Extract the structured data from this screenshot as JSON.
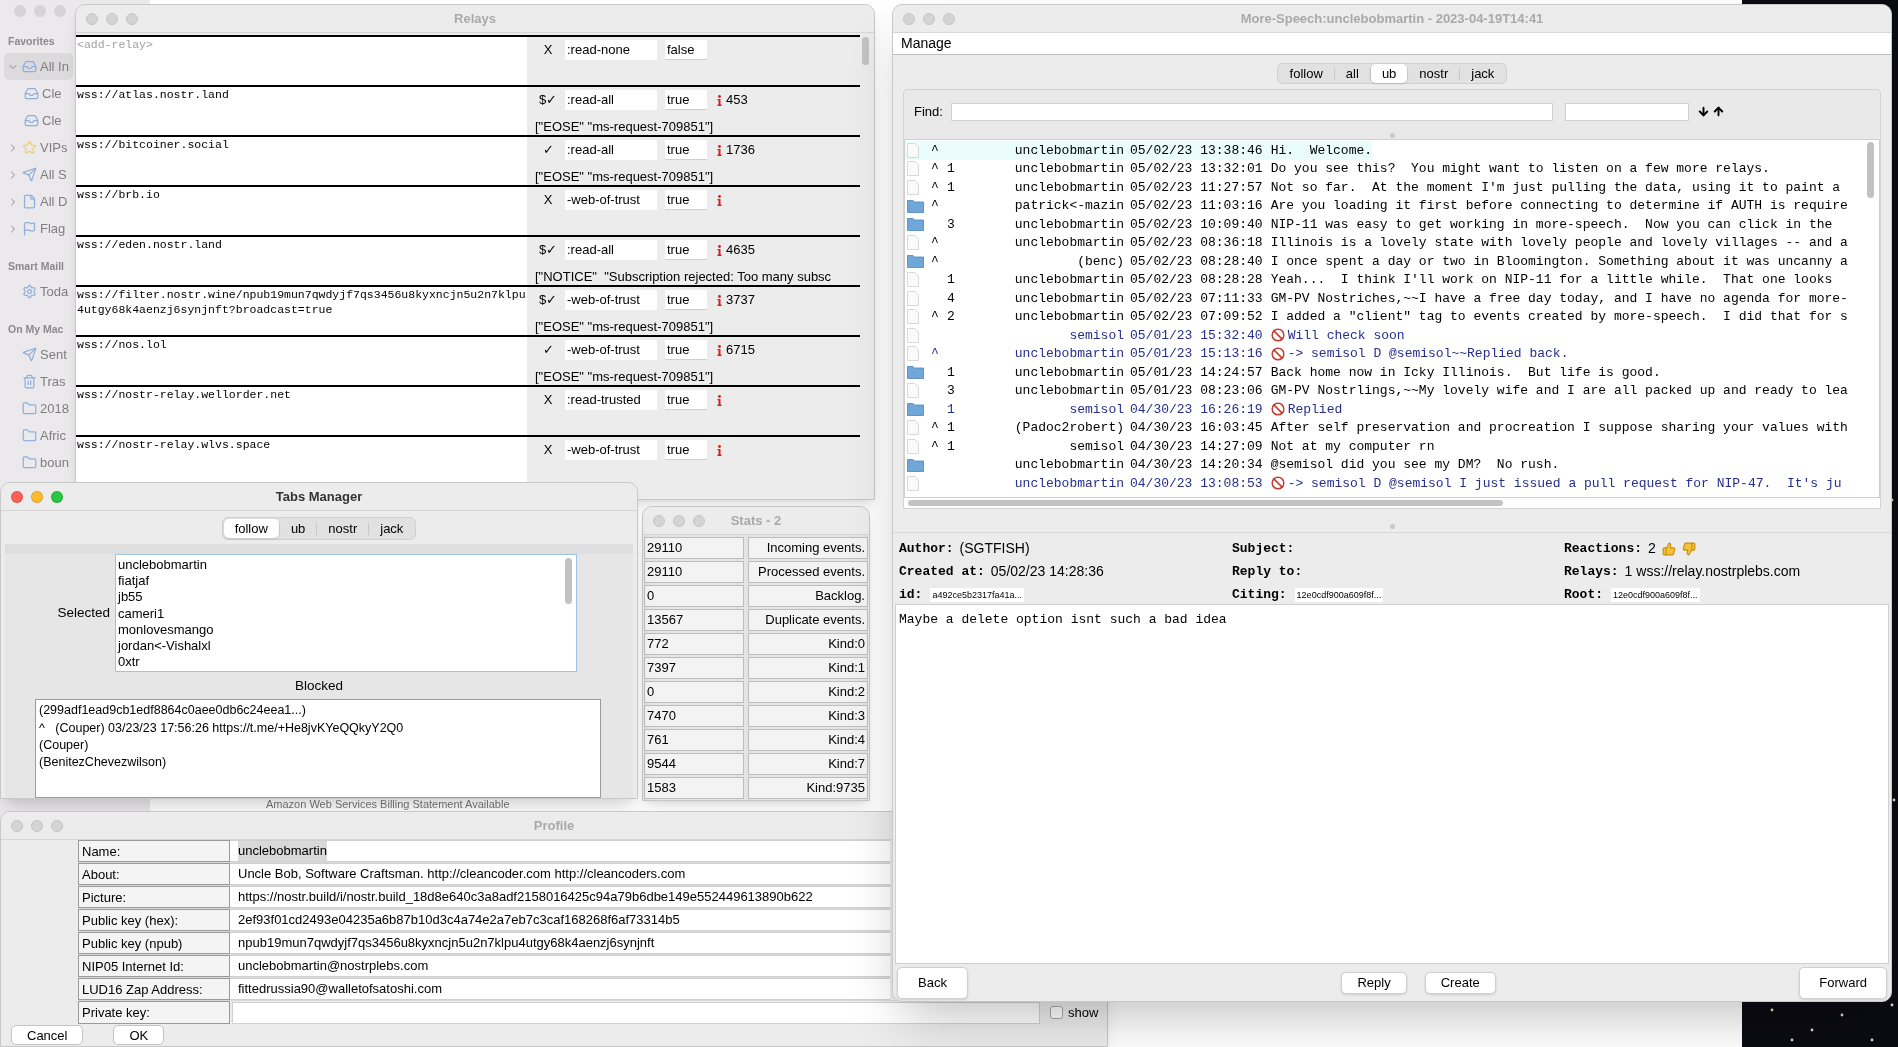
{
  "mail": {
    "sidebar": [
      {
        "title": "Favorites",
        "items": [
          {
            "label": "All In",
            "kind": "inbox",
            "expanded": true,
            "selected": true,
            "sub": false
          },
          {
            "label": "Cle",
            "kind": "inbox",
            "sub": true,
            "selected": false
          },
          {
            "label": "Cle",
            "kind": "inbox",
            "sub": true,
            "selected": false
          },
          {
            "label": "VIPs",
            "kind": "star",
            "expanded": false,
            "selected": false,
            "sub": false
          },
          {
            "label": "All S",
            "kind": "send",
            "expanded": false,
            "selected": false,
            "sub": false
          },
          {
            "label": "All D",
            "kind": "file",
            "expanded": false,
            "selected": false,
            "sub": false
          },
          {
            "label": "Flag",
            "kind": "flag",
            "expanded": false,
            "selected": false,
            "sub": false
          }
        ]
      },
      {
        "title": "Smart Maill",
        "items": [
          {
            "label": "Toda",
            "kind": "gear",
            "selected": false,
            "sub": false
          }
        ]
      },
      {
        "title": "On My Mac",
        "items": [
          {
            "label": "Sent",
            "kind": "send",
            "selected": false,
            "sub": false
          },
          {
            "label": "Tras",
            "kind": "trash",
            "selected": false,
            "sub": false
          },
          {
            "label": "2018",
            "kind": "folder",
            "selected": false,
            "sub": false
          },
          {
            "label": "Afric",
            "kind": "folder",
            "selected": false,
            "sub": false
          },
          {
            "label": "boun",
            "kind": "folder",
            "selected": false,
            "sub": false
          }
        ]
      }
    ],
    "message_subject": "Amazon Web Services Billing Statement Available"
  },
  "relays": {
    "title": "Relays",
    "active": false,
    "rows": [
      {
        "placeholder": "<add-relay>",
        "status": "X",
        "mode": ":read-none",
        "flag": "false",
        "info": false
      },
      {
        "url": "wss://atlas.nostr.land",
        "status": "$✓",
        "mode": ":read-all",
        "flag": "true",
        "info": true,
        "count": "453",
        "message": "[\"EOSE\" \"ms-request-709851\"]"
      },
      {
        "url": "wss://bitcoiner.social",
        "status": "✓",
        "mode": ":read-all",
        "flag": "true",
        "info": true,
        "count": "1736",
        "message": "[\"EOSE\" \"ms-request-709851\"]"
      },
      {
        "url": "wss://brb.io",
        "status": "X",
        "mode": "-web-of-trust",
        "flag": "true",
        "info": true
      },
      {
        "url": "wss://eden.nostr.land",
        "status": "$✓",
        "mode": ":read-all",
        "flag": "true",
        "info": true,
        "count": "4635",
        "message": "[\"NOTICE\"  \"Subscription rejected: Too many subsc"
      },
      {
        "url": "wss://filter.nostr.wine/npub19mun7qwdyjf7qs3456u8kyxncjn5u2n7klpu4utgy68k4aenzj6synjnft?broadcast=true",
        "status": "$✓",
        "mode": "-web-of-trust",
        "flag": "true",
        "info": true,
        "count": "3737",
        "message": "[\"EOSE\" \"ms-request-709851\"]"
      },
      {
        "url": "wss://nos.lol",
        "status": "✓",
        "mode": "-web-of-trust",
        "flag": "true",
        "info": true,
        "count": "6715",
        "message": "[\"EOSE\" \"ms-request-709851\"]"
      },
      {
        "url": "wss://nostr-relay.wellorder.net",
        "status": "X",
        "mode": ":read-trusted",
        "flag": "true",
        "info": true
      },
      {
        "url": "wss://nostr-relay.wlvs.space",
        "status": "X",
        "mode": "-web-of-trust",
        "flag": "true",
        "info": true
      }
    ]
  },
  "tabs_manager": {
    "title": "Tabs Manager",
    "active": true,
    "tabs": [
      {
        "label": "follow",
        "selected": true
      },
      {
        "label": "ub",
        "selected": false
      },
      {
        "label": "nostr",
        "selected": false
      },
      {
        "label": "jack",
        "selected": false
      }
    ],
    "selected_label": "Selected",
    "selected_list": [
      "unclebobmartin",
      "fiatjaf",
      "jb55",
      "cameri1",
      "monlovesmango",
      "jordan<-Vishalxl",
      "0xtr"
    ],
    "blocked_label": "Blocked",
    "blocked_list": [
      "(299adf1ead9cb1edf8864c0aee0db6c24eea1...)",
      "^   (Couper) 03/23/23 17:56:26 https://t.me/+He8jvKYeQQkyY2Q0",
      "(Couper)",
      "(BenitezChevezwilson)"
    ]
  },
  "stats": {
    "title": "Stats - 2",
    "active": false,
    "rows": [
      {
        "value": "29110",
        "label": "Incoming events."
      },
      {
        "value": "29110",
        "label": "Processed events."
      },
      {
        "value": "0",
        "label": "Backlog."
      },
      {
        "value": "13567",
        "label": "Duplicate events."
      },
      {
        "value": "772",
        "label": "Kind:0"
      },
      {
        "value": "7397",
        "label": "Kind:1"
      },
      {
        "value": "0",
        "label": "Kind:2"
      },
      {
        "value": "7470",
        "label": "Kind:3"
      },
      {
        "value": "761",
        "label": "Kind:4"
      },
      {
        "value": "9544",
        "label": "Kind:7"
      },
      {
        "value": "1583",
        "label": "Kind:9735"
      }
    ]
  },
  "profile": {
    "title": "Profile",
    "active": false,
    "fields": [
      {
        "label": "Name:",
        "value": "unclebobmartin",
        "highlighted": true
      },
      {
        "label": "About:",
        "value": "Uncle Bob, Software Craftsman.  http://cleancoder.com  http://cleancoders.com",
        "highlighted": false
      },
      {
        "label": "Picture:",
        "value": "https://nostr.build/i/nostr.build_18d8e640c3a8adf2158016425c94a79b6dbe149e552449613890b622",
        "highlighted": false
      },
      {
        "label": "Public key (hex):",
        "value": "2ef93f01cd2493e04235a6b87b10d3c4a74e2a7eb7c3caf168268f6af73314b5",
        "highlighted": false
      },
      {
        "label": "Public key (npub)",
        "value": "npub19mun7qwdyjf7qs3456u8kyxncjn5u2n7klpu4utgy68k4aenzj6synjnft",
        "highlighted": false
      },
      {
        "label": "NIP05 Internet Id:",
        "value": "unclebobmartin@nostrplebs.com",
        "highlighted": false
      },
      {
        "label": "LUD16 Zap Address:",
        "value": "fittedrussia90@walletofsatoshi.com",
        "highlighted": false
      }
    ],
    "private_key": {
      "label": "Private key:",
      "show_label": "show",
      "checked": false
    },
    "buttons": [
      "Cancel",
      "OK"
    ]
  },
  "more_speech": {
    "title": "More-Speech:unclebobmartin - 2023-04-19T14:41",
    "active": false,
    "menu": [
      "Manage"
    ],
    "tabs": [
      {
        "label": "follow",
        "selected": false
      },
      {
        "label": "all",
        "selected": false
      },
      {
        "label": "ub",
        "selected": true
      },
      {
        "label": "nostr",
        "selected": false
      },
      {
        "label": "jack",
        "selected": false
      }
    ],
    "find_label": "Find:",
    "messages": [
      {
        "kind": "note",
        "marker": "^",
        "author": "unclebobmartin",
        "time": "05/02/23 13:38:46",
        "text": "Hi.  Welcome.",
        "dm": false,
        "blocked": false,
        "selected": true
      },
      {
        "kind": "note",
        "marker": "^",
        "count": "1",
        "author": "unclebobmartin",
        "time": "05/02/23 13:32:01",
        "text": "Do you see this?  You might want to listen on a few more relays.",
        "dm": false,
        "blocked": false,
        "selected": false
      },
      {
        "kind": "note",
        "marker": "^",
        "count": "1",
        "author": "unclebobmartin",
        "time": "05/02/23 11:27:57",
        "text": "Not so far.  At the moment I'm just pulling the data, using it to paint a",
        "dm": false,
        "blocked": false,
        "selected": false
      },
      {
        "kind": "thread",
        "marker": "^",
        "author": "patrick<-mazin",
        "time": "05/02/23 11:03:16",
        "text": "Are you loading it first before connecting to determine if AUTH is require",
        "dm": false,
        "blocked": false,
        "selected": false
      },
      {
        "kind": "thread",
        "count": "3",
        "author": "unclebobmartin",
        "time": "05/02/23 10:09:40",
        "text": "NIP-11 was easy to get working in more-speech.  Now you can click in the",
        "dm": false,
        "blocked": false,
        "selected": false
      },
      {
        "kind": "note",
        "marker": "^",
        "author": "unclebobmartin",
        "time": "05/02/23 08:36:18",
        "text": "Illinois is a lovely state with lovely people and lovely villages -- and a",
        "dm": false,
        "blocked": false,
        "selected": false
      },
      {
        "kind": "thread",
        "marker": "^",
        "author": "(benc)",
        "time": "05/02/23 08:28:40",
        "text": "I once spent a day or two in Bloomington. Something about it was uncanny a",
        "dm": false,
        "blocked": false,
        "selected": false
      },
      {
        "kind": "note",
        "count": "1",
        "author": "unclebobmartin",
        "time": "05/02/23 08:28:28",
        "text": "Yeah...  I think I'll work on NIP-11 for a little while.  That one looks",
        "dm": false,
        "blocked": false,
        "selected": false
      },
      {
        "kind": "note",
        "count": "4",
        "author": "unclebobmartin",
        "time": "05/02/23 07:11:33",
        "text": "GM-PV Nostriches,~~I have a free day today, and I have no agenda for more-",
        "dm": false,
        "blocked": false,
        "selected": false
      },
      {
        "kind": "note",
        "marker": "^",
        "count": "2",
        "author": "unclebobmartin",
        "time": "05/02/23 07:09:52",
        "text": "I added a \"client\" tag to events created by more-speech.  I did that for s",
        "dm": false,
        "blocked": false,
        "selected": false
      },
      {
        "kind": "note",
        "author": "semisol",
        "time": "05/01/23 15:32:40",
        "text": "Will check soon",
        "dm": true,
        "blocked": true,
        "selected": false
      },
      {
        "kind": "note",
        "marker": "^",
        "author": "unclebobmartin",
        "time": "05/01/23 15:13:16",
        "text": "-> semisol D @semisol~~Replied back.",
        "dm": true,
        "blocked": true,
        "selected": false
      },
      {
        "kind": "thread",
        "count": "1",
        "author": "unclebobmartin",
        "time": "05/01/23 14:24:57",
        "text": "Back home now in Icky Illinois.  But life is good.",
        "dm": false,
        "blocked": false,
        "selected": false
      },
      {
        "kind": "note",
        "count": "3",
        "author": "unclebobmartin",
        "time": "05/01/23 08:23:06",
        "text": "GM-PV Nostrlings,~~My lovely wife and I are all packed up and ready to lea",
        "dm": false,
        "blocked": false,
        "selected": false
      },
      {
        "kind": "thread",
        "count": "1",
        "author": "semisol",
        "time": "04/30/23 16:26:19",
        "text": "Replied",
        "dm": true,
        "blocked": true,
        "selected": false
      },
      {
        "kind": "note",
        "marker": "^",
        "count": "1",
        "author": "(Padoc2robert)",
        "time": "04/30/23 16:03:45",
        "text": "After self preservation and procreation I suppose sharing your values with",
        "dm": false,
        "blocked": false,
        "selected": false
      },
      {
        "kind": "note",
        "marker": "^",
        "count": "1",
        "author": "semisol",
        "time": "04/30/23 14:27:09",
        "text": "Not at my computer rn",
        "dm": false,
        "blocked": false,
        "selected": false
      },
      {
        "kind": "thread",
        "author": "unclebobmartin",
        "time": "04/30/23 14:20:34",
        "text": "@semisol did you see my DM?  No rush.",
        "dm": false,
        "blocked": false,
        "selected": false
      },
      {
        "kind": "note",
        "author": "unclebobmartin",
        "time": "04/30/23 13:08:53",
        "text": "-> semisol D @semisol I just issued a pull request for NIP-47.  It's ju",
        "dm": true,
        "blocked": true,
        "selected": false
      }
    ],
    "details": {
      "author_label": "Author:",
      "author": "(SGTFISH)",
      "subject_label": "Subject:",
      "reactions_label": "Reactions:",
      "reactions": "2",
      "created_label": "Created at:",
      "created": "05/02/23 14:28:36",
      "reply_label": "Reply to:",
      "relays_label": "Relays:",
      "relays": "1 wss://relay.nostrplebs.com",
      "id_label": "id:",
      "id": "a492ce5b2317fa41a...",
      "citing_label": "Citing:",
      "citing": "12e0cdf900a609f8f...",
      "root_label": "Root:",
      "root": "12e0cdf900a609f8f..."
    },
    "body": "Maybe a delete option isnt such a bad idea",
    "buttons": {
      "back": "Back",
      "reply": "Reply",
      "create": "Create",
      "forward": "Forward"
    }
  }
}
